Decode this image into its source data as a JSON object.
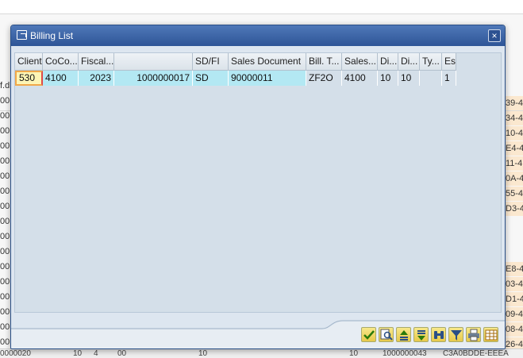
{
  "dialog": {
    "title": "Billing List",
    "close_label": "×"
  },
  "table": {
    "columns": [
      "Client",
      "CoCo...",
      "Fiscal...",
      "",
      "SD/FI",
      "Sales Document",
      "Bill. T...",
      "Sales...",
      "Di...",
      "Di...",
      "Ty...",
      "Es"
    ],
    "rows": [
      [
        "530",
        "4100",
        "2023",
        "1000000017",
        "SD",
        "90000011",
        "ZF2O",
        "4100",
        "10",
        "10",
        "",
        "1"
      ]
    ]
  },
  "background": {
    "left_fragments": [
      "00",
      "00",
      "f.d",
      "00",
      "00",
      "00",
      "00",
      "00",
      "00",
      "00",
      "00",
      "00",
      "00",
      "00",
      "00",
      "00",
      "00",
      "00",
      "00"
    ],
    "right_fragments": [
      "39-4",
      "34-4",
      "10-4",
      "E4-4",
      "11-4",
      "0A-4",
      "55-4",
      "D3-4",
      "",
      "",
      "",
      "E8-4",
      "03-4",
      "D1-4",
      "09-4",
      "08-4",
      "26-4"
    ],
    "bottom_fragments": [
      "0000020",
      "10",
      "4",
      "00",
      "10",
      "10",
      "1000000043",
      "C3A0BDDE-EEEA"
    ]
  }
}
